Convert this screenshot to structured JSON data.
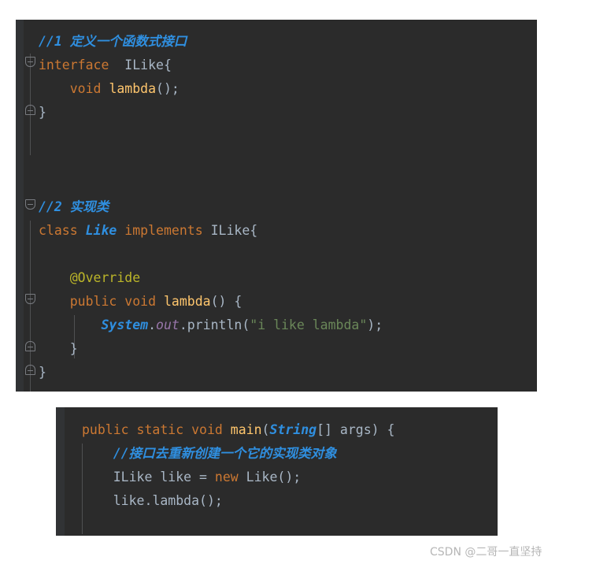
{
  "blocks": [
    {
      "id": "interface-block",
      "lines": [
        {
          "tokens": [
            {
              "c": "t-comment",
              "t": "//1 定义一个函数式接口"
            }
          ]
        },
        {
          "tokens": [
            {
              "c": "t-keyword",
              "t": "interface"
            },
            {
              "c": "t-punct",
              "t": "  "
            },
            {
              "c": "t-type",
              "t": "ILike"
            },
            {
              "c": "t-brace",
              "t": "{"
            }
          ]
        },
        {
          "tokens": [
            {
              "c": "t-punct",
              "t": "    "
            },
            {
              "c": "t-keyword",
              "t": "void"
            },
            {
              "c": "t-punct",
              "t": " "
            },
            {
              "c": "t-method",
              "t": "lambda"
            },
            {
              "c": "t-paren",
              "t": "()"
            },
            {
              "c": "t-punct",
              "t": ";"
            }
          ]
        },
        {
          "tokens": [
            {
              "c": "t-brace",
              "t": "}"
            }
          ]
        },
        {
          "tokens": []
        },
        {
          "tokens": []
        },
        {
          "tokens": []
        },
        {
          "tokens": [
            {
              "c": "t-comment",
              "t": "//2 实现类"
            }
          ]
        },
        {
          "tokens": [
            {
              "c": "t-keyword",
              "t": "class"
            },
            {
              "c": "t-punct",
              "t": " "
            },
            {
              "c": "t-classref",
              "t": "Like"
            },
            {
              "c": "t-punct",
              "t": " "
            },
            {
              "c": "t-keyword",
              "t": "implements"
            },
            {
              "c": "t-punct",
              "t": " "
            },
            {
              "c": "t-type",
              "t": "ILike"
            },
            {
              "c": "t-brace",
              "t": "{"
            }
          ]
        },
        {
          "tokens": []
        },
        {
          "tokens": [
            {
              "c": "t-punct",
              "t": "    "
            },
            {
              "c": "t-anno",
              "t": "@Override"
            }
          ]
        },
        {
          "tokens": [
            {
              "c": "t-punct",
              "t": "    "
            },
            {
              "c": "t-keyword",
              "t": "public"
            },
            {
              "c": "t-punct",
              "t": " "
            },
            {
              "c": "t-keyword",
              "t": "void"
            },
            {
              "c": "t-punct",
              "t": " "
            },
            {
              "c": "t-method",
              "t": "lambda"
            },
            {
              "c": "t-paren",
              "t": "()"
            },
            {
              "c": "t-punct",
              "t": " "
            },
            {
              "c": "t-brace",
              "t": "{"
            }
          ]
        },
        {
          "tokens": [
            {
              "c": "t-punct",
              "t": "        "
            },
            {
              "c": "t-classref",
              "t": "System"
            },
            {
              "c": "t-punct",
              "t": "."
            },
            {
              "c": "t-static",
              "t": "out"
            },
            {
              "c": "t-punct",
              "t": "."
            },
            {
              "c": "t-ident",
              "t": "println"
            },
            {
              "c": "t-paren",
              "t": "("
            },
            {
              "c": "t-string",
              "t": "\"i like lambda\""
            },
            {
              "c": "t-paren",
              "t": ")"
            },
            {
              "c": "t-punct",
              "t": ";"
            }
          ]
        },
        {
          "tokens": [
            {
              "c": "t-punct",
              "t": "    "
            },
            {
              "c": "t-brace",
              "t": "}"
            }
          ]
        },
        {
          "tokens": [
            {
              "c": "t-brace",
              "t": "}"
            }
          ]
        }
      ]
    },
    {
      "id": "main-block",
      "lines": [
        {
          "tokens": [
            {
              "c": "t-keyword",
              "t": "public"
            },
            {
              "c": "t-punct",
              "t": " "
            },
            {
              "c": "t-keyword",
              "t": "static"
            },
            {
              "c": "t-punct",
              "t": " "
            },
            {
              "c": "t-keyword",
              "t": "void"
            },
            {
              "c": "t-punct",
              "t": " "
            },
            {
              "c": "t-method",
              "t": "main"
            },
            {
              "c": "t-paren",
              "t": "("
            },
            {
              "c": "t-classref",
              "t": "String"
            },
            {
              "c": "t-punct",
              "t": "[] "
            },
            {
              "c": "t-param",
              "t": "args"
            },
            {
              "c": "t-paren",
              "t": ")"
            },
            {
              "c": "t-punct",
              "t": " "
            },
            {
              "c": "t-brace",
              "t": "{"
            }
          ]
        },
        {
          "tokens": [
            {
              "c": "t-punct",
              "t": "    "
            },
            {
              "c": "t-comment",
              "t": "//接口去重新创建一个它的实现类对象"
            }
          ]
        },
        {
          "tokens": [
            {
              "c": "t-punct",
              "t": "    "
            },
            {
              "c": "t-type",
              "t": "ILike"
            },
            {
              "c": "t-punct",
              "t": " "
            },
            {
              "c": "t-ident",
              "t": "like"
            },
            {
              "c": "t-punct",
              "t": " = "
            },
            {
              "c": "t-keyword",
              "t": "new"
            },
            {
              "c": "t-punct",
              "t": " "
            },
            {
              "c": "t-type",
              "t": "Like"
            },
            {
              "c": "t-paren",
              "t": "()"
            },
            {
              "c": "t-punct",
              "t": ";"
            }
          ]
        },
        {
          "tokens": [
            {
              "c": "t-punct",
              "t": "    "
            },
            {
              "c": "t-ident",
              "t": "like"
            },
            {
              "c": "t-punct",
              "t": "."
            },
            {
              "c": "t-ident",
              "t": "lambda"
            },
            {
              "c": "t-paren",
              "t": "()"
            },
            {
              "c": "t-punct",
              "t": ";"
            }
          ]
        }
      ]
    }
  ],
  "watermark": {
    "text": "CSDN @二哥一直坚持"
  },
  "colors": {
    "editor_background": "#2b2b2b",
    "gutter_background": "#313335",
    "comment": "#2f8fe0",
    "keyword": "#cc7832",
    "method": "#ffc66d",
    "annotation": "#bbb529",
    "string": "#6a8759",
    "static_field": "#9876aa",
    "identifier": "#a9b7c6",
    "page_background": "#ffffff",
    "watermark": "#b6b6b6"
  }
}
